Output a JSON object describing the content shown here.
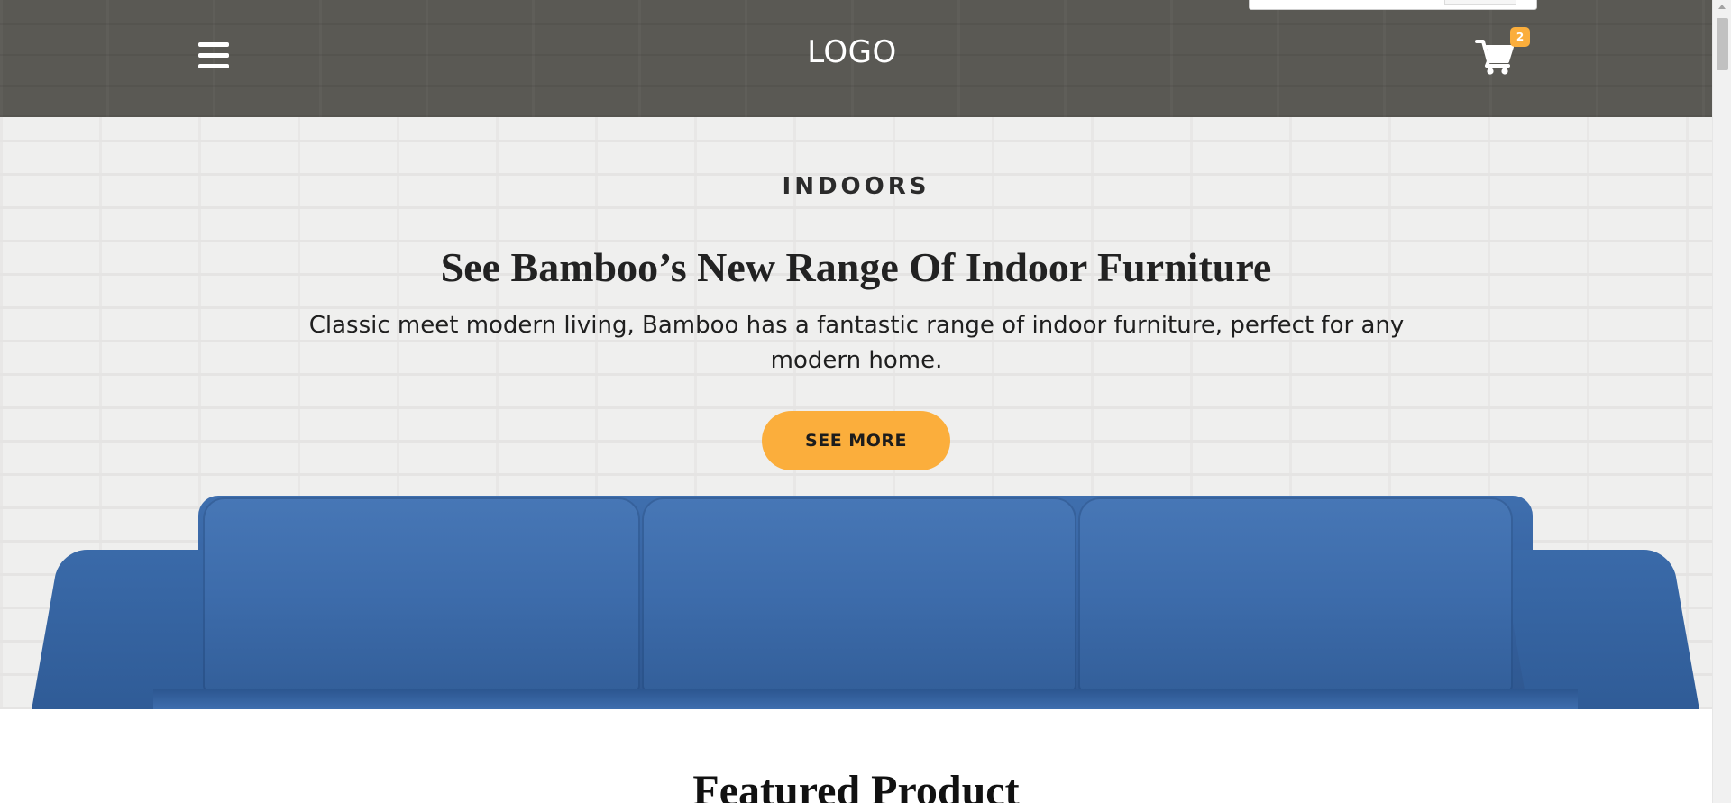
{
  "header": {
    "logo": "LOGO",
    "cart_count": "2",
    "colors": {
      "background": "#5a5954",
      "badge": "#fbae3c"
    },
    "icons": {
      "menu": "hamburger-menu-icon",
      "cart": "shopping-cart-icon"
    }
  },
  "hero": {
    "eyebrow": "INDOORS",
    "title": "See Bamboo’s New Range Of Indoor Furniture",
    "description": "Classic meet modern living, Bamboo has a fantastic range of indoor furniture, perfect for any modern home.",
    "cta_label": "SEE MORE",
    "colors": {
      "accent": "#fbae3c"
    }
  },
  "featured": {
    "title": "Featured Product"
  }
}
